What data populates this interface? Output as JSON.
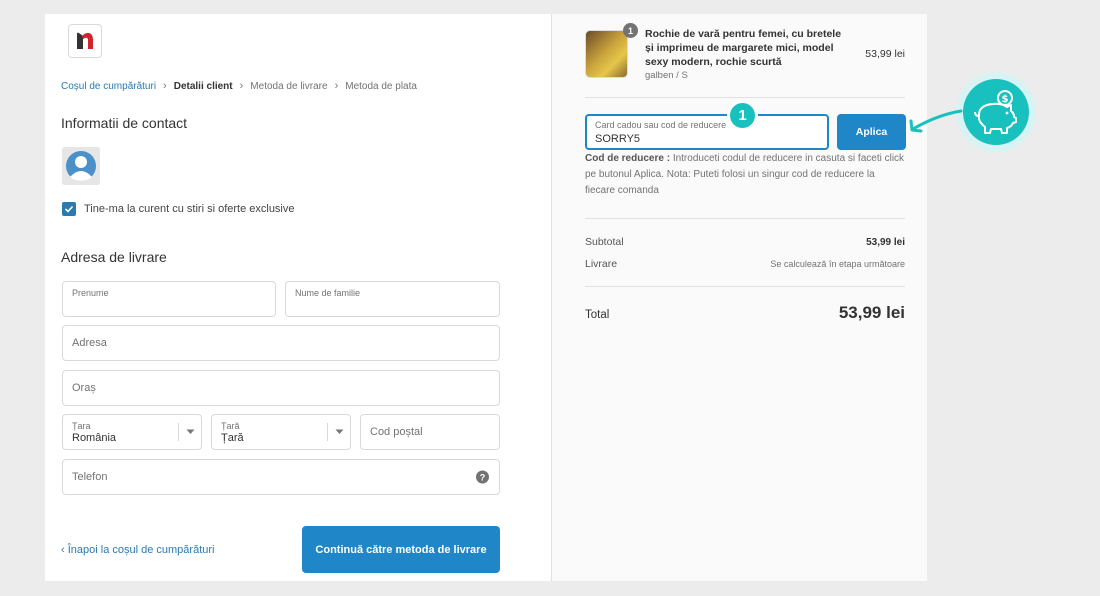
{
  "header": {
    "breadcrumb": [
      "Coșul de cumpărături",
      "Detalii client",
      "Metoda de livrare",
      "Metoda de plata"
    ]
  },
  "contact": {
    "title": "Informatii de contact",
    "newsletter_label": "Tine-ma la curent cu stiri si oferte exclusive",
    "newsletter_checked": true
  },
  "shipping": {
    "title": "Adresa de livrare",
    "first_name_label": "Prenume",
    "last_name_label": "Nume de familie",
    "address_placeholder": "Adresa",
    "city_placeholder": "Oraș",
    "country_label": "Țara",
    "country_value": "România",
    "region_label": "Țară",
    "region_value": "Țară",
    "postal_placeholder": "Cod poștal",
    "phone_placeholder": "Telefon"
  },
  "footer": {
    "back_link": "‹ Înapoi la coșul de cumpărături",
    "continue_button": "Continuă către metoda de livrare"
  },
  "order": {
    "product": {
      "name": "Rochie de vară pentru femei, cu bretele și imprimeu de margarete mici, model sexy modern, rochie scurtă",
      "variant": "galben / S",
      "price": "53,99 lei",
      "quantity": "1"
    },
    "discount": {
      "label": "Card cadou sau cod de reducere",
      "value": "SORRY5",
      "apply_button": "Aplica",
      "step_number": "1",
      "note_title": "Cod de reducere :",
      "note_text": "Introduceti codul de reducere in casuta si faceti click pe butonul Aplica.   Nota: Puteti folosi un singur cod de reducere la fiecare comanda"
    },
    "subtotal_label": "Subtotal",
    "subtotal_value": "53,99 lei",
    "shipping_label": "Livrare",
    "shipping_value": "Se calculează în etapa următoare",
    "total_label": "Total",
    "total_value": "53,99 lei"
  },
  "colors": {
    "accent": "#1f86c7",
    "link": "#2a7ab0",
    "teal": "#19c1be",
    "logo_red": "#d1232a"
  },
  "icons": [
    "store-logo-icon",
    "chevron-right-icon",
    "avatar-icon",
    "checkmark-icon",
    "chevron-down-icon",
    "help-icon",
    "piggy-bank-icon",
    "arrow-icon"
  ]
}
